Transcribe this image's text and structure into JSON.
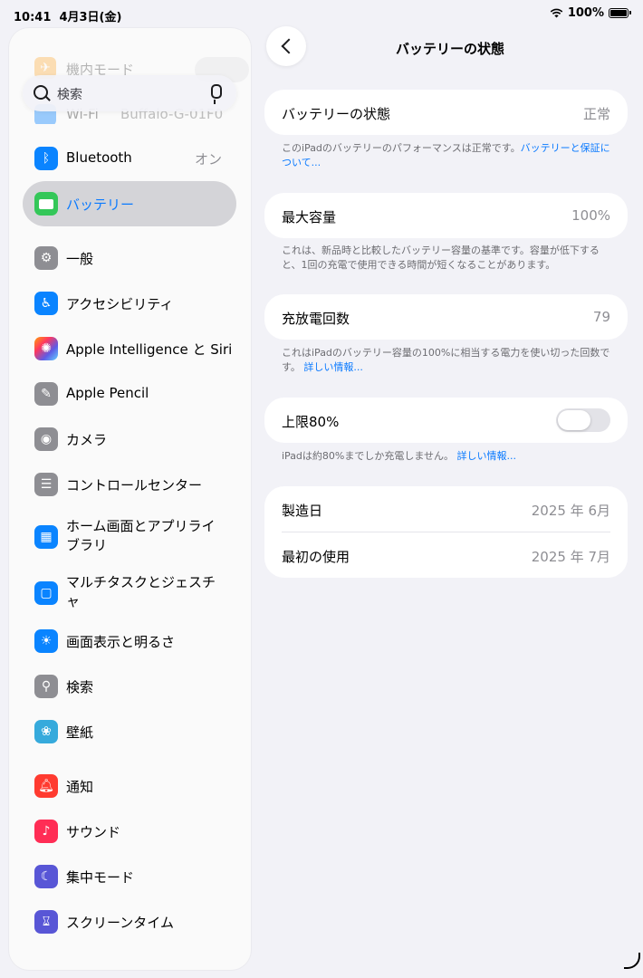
{
  "status": {
    "time": "10:41",
    "date": "4月3日(金)",
    "battery": "100%"
  },
  "sidebar": {
    "faded_top": {
      "label": "機内モード"
    },
    "faded_wifi": {
      "label": "Wi-Fi",
      "value": "Buffalo-G-01F0"
    },
    "search_placeholder": "検索",
    "items": [
      {
        "label": "Bluetooth",
        "value": "オン",
        "icon": "bluetooth-icon",
        "color": "#0a84ff"
      },
      {
        "label": "バッテリー",
        "icon": "battery-icon",
        "color": "#34c759",
        "selected": true
      },
      {
        "label": "一般",
        "icon": "gear-icon",
        "color": "#8e8e93"
      },
      {
        "label": "アクセシビリティ",
        "icon": "accessibility-icon",
        "color": "#0a84ff"
      },
      {
        "label": "Apple Intelligence と Siri",
        "icon": "siri-icon",
        "color": "#ff6b3d"
      },
      {
        "label": "Apple Pencil",
        "icon": "pencil-icon",
        "color": "#8e8e93"
      },
      {
        "label": "カメラ",
        "icon": "camera-icon",
        "color": "#8e8e93"
      },
      {
        "label": "コントロールセンター",
        "icon": "control-center-icon",
        "color": "#8e8e93"
      },
      {
        "label": "ホーム画面とアプリライブラリ",
        "icon": "home-screen-icon",
        "color": "#0a84ff"
      },
      {
        "label": "マルチタスクとジェスチャ",
        "icon": "multitasking-icon",
        "color": "#0a84ff"
      },
      {
        "label": "画面表示と明るさ",
        "icon": "brightness-icon",
        "color": "#0a84ff"
      },
      {
        "label": "検索",
        "icon": "search-icon",
        "color": "#8e8e93"
      },
      {
        "label": "壁紙",
        "icon": "wallpaper-icon",
        "color": "#36aadc"
      },
      {
        "label": "通知",
        "icon": "notification-icon",
        "color": "#ff3b30"
      },
      {
        "label": "サウンド",
        "icon": "sound-icon",
        "color": "#ff2d55"
      },
      {
        "label": "集中モード",
        "icon": "focus-icon",
        "color": "#5856d6"
      },
      {
        "label": "スクリーンタイム",
        "icon": "hourglass-icon",
        "color": "#5856d6"
      }
    ]
  },
  "detail": {
    "title": "バッテリーの状態",
    "health": {
      "label": "バッテリーの状態",
      "value": "正常"
    },
    "health_note": "このiPadのバッテリーのパフォーマンスは正常です。",
    "health_link": "バッテリーと保証について...",
    "capacity": {
      "label": "最大容量",
      "value": "100%"
    },
    "capacity_note": "これは、新品時と比較したバッテリー容量の基準です。容量が低下すると、1回の充電で使用できる時間が短くなることがあります。",
    "cycles": {
      "label": "充放電回数",
      "value": "79"
    },
    "cycles_note": "これはiPadのバッテリー容量の100%に相当する電力を使い切った回数です。",
    "cycles_link": "詳しい情報...",
    "limit": {
      "label": "上限80%",
      "on": false
    },
    "limit_note": "iPadは約80%までしか充電しません。",
    "limit_link": "詳しい情報...",
    "manufacture": {
      "label": "製造日",
      "value": "2025 年 6月"
    },
    "first_use": {
      "label": "最初の使用",
      "value": "2025 年 7月"
    }
  }
}
